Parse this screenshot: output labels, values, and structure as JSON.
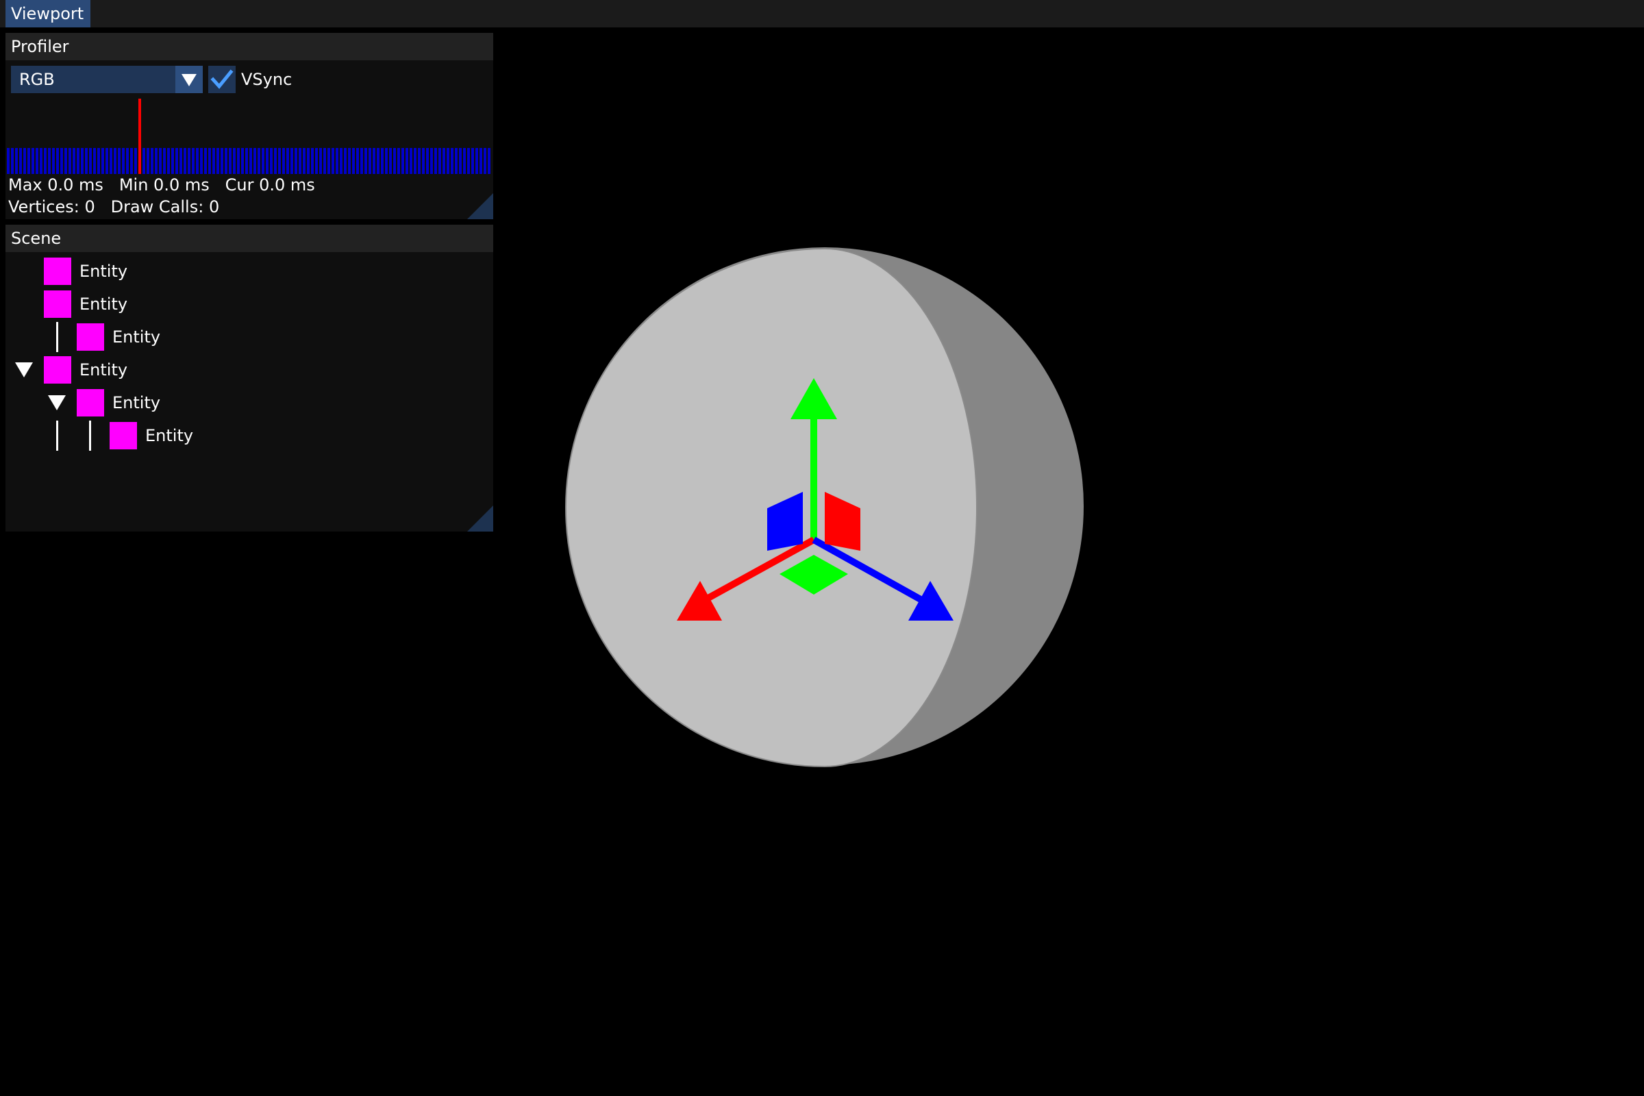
{
  "menubar": {
    "viewport_tab": "Viewport"
  },
  "profiler": {
    "title": "Profiler",
    "mode_select": {
      "value": "RGB"
    },
    "vsync": {
      "label": "VSync",
      "checked": true
    },
    "stats": {
      "max": "Max 0.0 ms",
      "min": "Min 0.0 ms",
      "cur": "Cur 0.0 ms",
      "vertices": "Vertices: 0",
      "draw_calls": "Draw Calls: 0"
    },
    "colors": {
      "graph_bar": "#0000cc",
      "spike": "#ff0000"
    }
  },
  "scene": {
    "title": "Scene",
    "entities": [
      {
        "label": "Entity",
        "depth": 0,
        "expanded": false
      },
      {
        "label": "Entity",
        "depth": 0,
        "expanded": false
      },
      {
        "label": "Entity",
        "depth": 1,
        "expanded": false
      },
      {
        "label": "Entity",
        "depth": 0,
        "expanded": true
      },
      {
        "label": "Entity",
        "depth": 1,
        "expanded": true
      },
      {
        "label": "Entity",
        "depth": 2,
        "expanded": false
      }
    ],
    "colors": {
      "entity_icon": "#ff00ff"
    }
  },
  "viewport": {
    "object": "sphere",
    "gizmo_icons": [
      "x-axis-arrow-icon",
      "y-axis-arrow-icon",
      "z-axis-arrow-icon"
    ],
    "colors": {
      "sphere_face": "#c0c0c0",
      "sphere_shade": "#868686",
      "x_axis": "#ff0000",
      "y_axis": "#00ff00",
      "z_axis": "#0000ff"
    }
  }
}
